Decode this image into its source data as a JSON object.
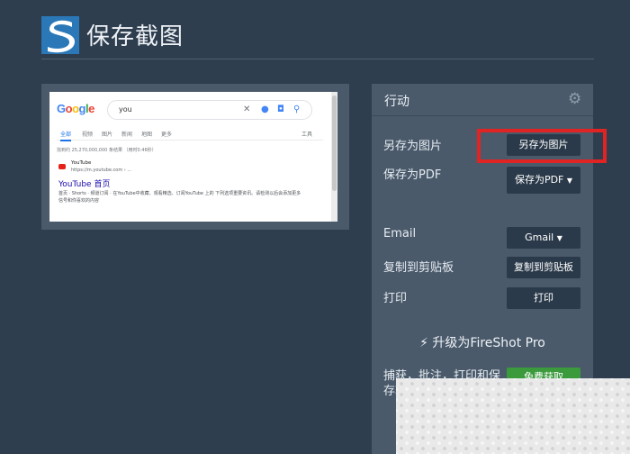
{
  "header": {
    "title": "保存截图"
  },
  "preview": {
    "google_logo": "Google",
    "query": "you",
    "tabs": [
      "全部",
      "视频",
      "图片",
      "新闻",
      "地图",
      "更多"
    ],
    "tools": "工具",
    "stats": "找到约 25,270,000,000 条结果 （用时0.46秒）",
    "result": {
      "site": "YouTube",
      "url": "https://m.youtube.com › ...",
      "title": "YouTube 首页",
      "desc": "首页 · Shorts · 频道订阅 · 在YouTube中收藏、观看精选、订阅YouTube 上的 下列选项重要资讯。请检测以后会添加更多信号和你喜欢的内容"
    }
  },
  "panel": {
    "title": "行动",
    "rows": {
      "save_image_label": "另存为图片",
      "save_image_button": "另存为图片",
      "save_pdf_label": "保存为PDF",
      "save_pdf_button": "保存为PDF",
      "email_label": "Email",
      "email_button": "Gmail",
      "clipboard_label": "复制到剪贴板",
      "clipboard_button": "复制到剪贴板",
      "print_label": "打印",
      "print_button": "打印"
    },
    "upgrade_text": "升级为FireShot Pro",
    "promo_text": "捕获，批注，打印和保存转发送One另一",
    "free_button": "免费获取"
  },
  "colors": {
    "background": "#2e3e4f",
    "panel": "#4a5a6b",
    "button": "#2b3a4a",
    "highlight": "#e02424",
    "green": "#3a9a3c"
  }
}
